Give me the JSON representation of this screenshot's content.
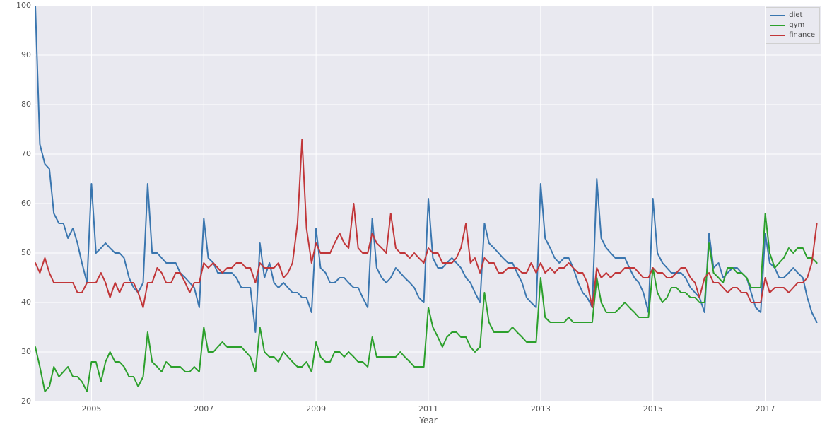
{
  "chart_data": {
    "type": "line",
    "xlabel": "Year",
    "ylabel": "",
    "xlim": [
      2004.0,
      2018.0
    ],
    "ylim": [
      20,
      100
    ],
    "yticks": [
      20,
      30,
      40,
      50,
      60,
      70,
      80,
      90,
      100
    ],
    "xticks": [
      2005,
      2007,
      2009,
      2011,
      2013,
      2015,
      2017
    ],
    "x": [
      2004.0,
      2004.08,
      2004.17,
      2004.25,
      2004.33,
      2004.42,
      2004.5,
      2004.58,
      2004.67,
      2004.75,
      2004.83,
      2004.92,
      2005.0,
      2005.08,
      2005.17,
      2005.25,
      2005.33,
      2005.42,
      2005.5,
      2005.58,
      2005.67,
      2005.75,
      2005.83,
      2005.92,
      2006.0,
      2006.08,
      2006.17,
      2006.25,
      2006.33,
      2006.42,
      2006.5,
      2006.58,
      2006.67,
      2006.75,
      2006.83,
      2006.92,
      2007.0,
      2007.08,
      2007.17,
      2007.25,
      2007.33,
      2007.42,
      2007.5,
      2007.58,
      2007.67,
      2007.75,
      2007.83,
      2007.92,
      2008.0,
      2008.08,
      2008.17,
      2008.25,
      2008.33,
      2008.42,
      2008.5,
      2008.58,
      2008.67,
      2008.75,
      2008.83,
      2008.92,
      2009.0,
      2009.08,
      2009.17,
      2009.25,
      2009.33,
      2009.42,
      2009.5,
      2009.58,
      2009.67,
      2009.75,
      2009.83,
      2009.92,
      2010.0,
      2010.08,
      2010.17,
      2010.25,
      2010.33,
      2010.42,
      2010.5,
      2010.58,
      2010.67,
      2010.75,
      2010.83,
      2010.92,
      2011.0,
      2011.08,
      2011.17,
      2011.25,
      2011.33,
      2011.42,
      2011.5,
      2011.58,
      2011.67,
      2011.75,
      2011.83,
      2011.92,
      2012.0,
      2012.08,
      2012.17,
      2012.25,
      2012.33,
      2012.42,
      2012.5,
      2012.58,
      2012.67,
      2012.75,
      2012.83,
      2012.92,
      2013.0,
      2013.08,
      2013.17,
      2013.25,
      2013.33,
      2013.42,
      2013.5,
      2013.58,
      2013.67,
      2013.75,
      2013.83,
      2013.92,
      2014.0,
      2014.08,
      2014.17,
      2014.25,
      2014.33,
      2014.42,
      2014.5,
      2014.58,
      2014.67,
      2014.75,
      2014.83,
      2014.92,
      2015.0,
      2015.08,
      2015.17,
      2015.25,
      2015.33,
      2015.42,
      2015.5,
      2015.58,
      2015.67,
      2015.75,
      2015.83,
      2015.92,
      2016.0,
      2016.08,
      2016.17,
      2016.25,
      2016.33,
      2016.42,
      2016.5,
      2016.58,
      2016.67,
      2016.75,
      2016.83,
      2016.92,
      2017.0,
      2017.08,
      2017.17,
      2017.25,
      2017.33,
      2017.42,
      2017.5,
      2017.58,
      2017.67,
      2017.75,
      2017.83,
      2017.92
    ],
    "series": [
      {
        "name": "diet",
        "color": "#3a76af",
        "values": [
          100,
          72,
          68,
          67,
          58,
          56,
          56,
          53,
          55,
          52,
          48,
          44,
          64,
          50,
          51,
          52,
          51,
          50,
          50,
          49,
          45,
          43,
          42,
          44,
          64,
          50,
          50,
          49,
          48,
          48,
          48,
          46,
          45,
          44,
          43,
          39,
          57,
          49,
          48,
          46,
          46,
          46,
          46,
          45,
          43,
          43,
          43,
          34,
          52,
          45,
          48,
          44,
          43,
          44,
          43,
          42,
          42,
          41,
          41,
          38,
          55,
          47,
          46,
          44,
          44,
          45,
          45,
          44,
          43,
          43,
          41,
          39,
          57,
          47,
          45,
          44,
          45,
          47,
          46,
          45,
          44,
          43,
          41,
          40,
          61,
          49,
          47,
          47,
          48,
          49,
          48,
          47,
          45,
          44,
          42,
          40,
          56,
          52,
          51,
          50,
          49,
          48,
          48,
          46,
          44,
          41,
          40,
          39,
          64,
          53,
          51,
          49,
          48,
          49,
          49,
          47,
          44,
          42,
          41,
          39,
          65,
          53,
          51,
          50,
          49,
          49,
          49,
          47,
          45,
          44,
          42,
          38,
          61,
          50,
          48,
          47,
          46,
          46,
          46,
          45,
          43,
          42,
          41,
          38,
          54,
          47,
          48,
          45,
          46,
          47,
          47,
          46,
          45,
          42,
          39,
          38,
          54,
          48,
          47,
          45,
          45,
          46,
          47,
          46,
          45,
          41,
          38,
          36
        ]
      },
      {
        "name": "gym",
        "color": "#2ca02c",
        "values": [
          31,
          27,
          22,
          23,
          27,
          25,
          26,
          27,
          25,
          25,
          24,
          22,
          28,
          28,
          24,
          28,
          30,
          28,
          28,
          27,
          25,
          25,
          23,
          25,
          34,
          28,
          27,
          26,
          28,
          27,
          27,
          27,
          26,
          26,
          27,
          26,
          35,
          30,
          30,
          31,
          32,
          31,
          31,
          31,
          31,
          30,
          29,
          26,
          35,
          30,
          29,
          29,
          28,
          30,
          29,
          28,
          27,
          27,
          28,
          26,
          32,
          29,
          28,
          28,
          30,
          30,
          29,
          30,
          29,
          28,
          28,
          27,
          33,
          29,
          29,
          29,
          29,
          29,
          30,
          29,
          28,
          27,
          27,
          27,
          39,
          35,
          33,
          31,
          33,
          34,
          34,
          33,
          33,
          31,
          30,
          31,
          42,
          36,
          34,
          34,
          34,
          34,
          35,
          34,
          33,
          32,
          32,
          32,
          45,
          37,
          36,
          36,
          36,
          36,
          37,
          36,
          36,
          36,
          36,
          36,
          45,
          40,
          38,
          38,
          38,
          39,
          40,
          39,
          38,
          37,
          37,
          37,
          47,
          42,
          40,
          41,
          43,
          43,
          42,
          42,
          41,
          41,
          40,
          40,
          52,
          46,
          45,
          44,
          47,
          47,
          46,
          46,
          45,
          43,
          43,
          43,
          58,
          50,
          47,
          48,
          49,
          51,
          50,
          51,
          51,
          49,
          49,
          48
        ]
      },
      {
        "name": "finance",
        "color": "#c13639",
        "values": [
          48,
          46,
          49,
          46,
          44,
          44,
          44,
          44,
          44,
          42,
          42,
          44,
          44,
          44,
          46,
          44,
          41,
          44,
          42,
          44,
          44,
          44,
          42,
          39,
          44,
          44,
          47,
          46,
          44,
          44,
          46,
          46,
          44,
          42,
          44,
          44,
          48,
          47,
          48,
          47,
          46,
          47,
          47,
          48,
          48,
          47,
          47,
          44,
          48,
          47,
          47,
          47,
          48,
          45,
          46,
          48,
          56,
          73,
          55,
          48,
          52,
          50,
          50,
          50,
          52,
          54,
          52,
          51,
          60,
          51,
          50,
          50,
          54,
          52,
          51,
          50,
          58,
          51,
          50,
          50,
          49,
          50,
          49,
          48,
          51,
          50,
          50,
          48,
          48,
          48,
          49,
          51,
          56,
          48,
          49,
          46,
          49,
          48,
          48,
          46,
          46,
          47,
          47,
          47,
          46,
          46,
          48,
          46,
          48,
          46,
          47,
          46,
          47,
          47,
          48,
          47,
          46,
          46,
          44,
          39,
          47,
          45,
          46,
          45,
          46,
          46,
          47,
          47,
          47,
          46,
          45,
          45,
          47,
          46,
          46,
          45,
          45,
          46,
          47,
          47,
          45,
          44,
          41,
          45,
          46,
          44,
          44,
          43,
          42,
          43,
          43,
          42,
          42,
          40,
          40,
          40,
          45,
          42,
          43,
          43,
          43,
          42,
          43,
          44,
          44,
          45,
          48,
          56
        ]
      }
    ],
    "legend": [
      "diet",
      "gym",
      "finance"
    ]
  },
  "colors": {
    "diet": "#3a76af",
    "gym": "#2ca02c",
    "finance": "#c13639"
  },
  "labels": {
    "xlabel": "Year"
  }
}
